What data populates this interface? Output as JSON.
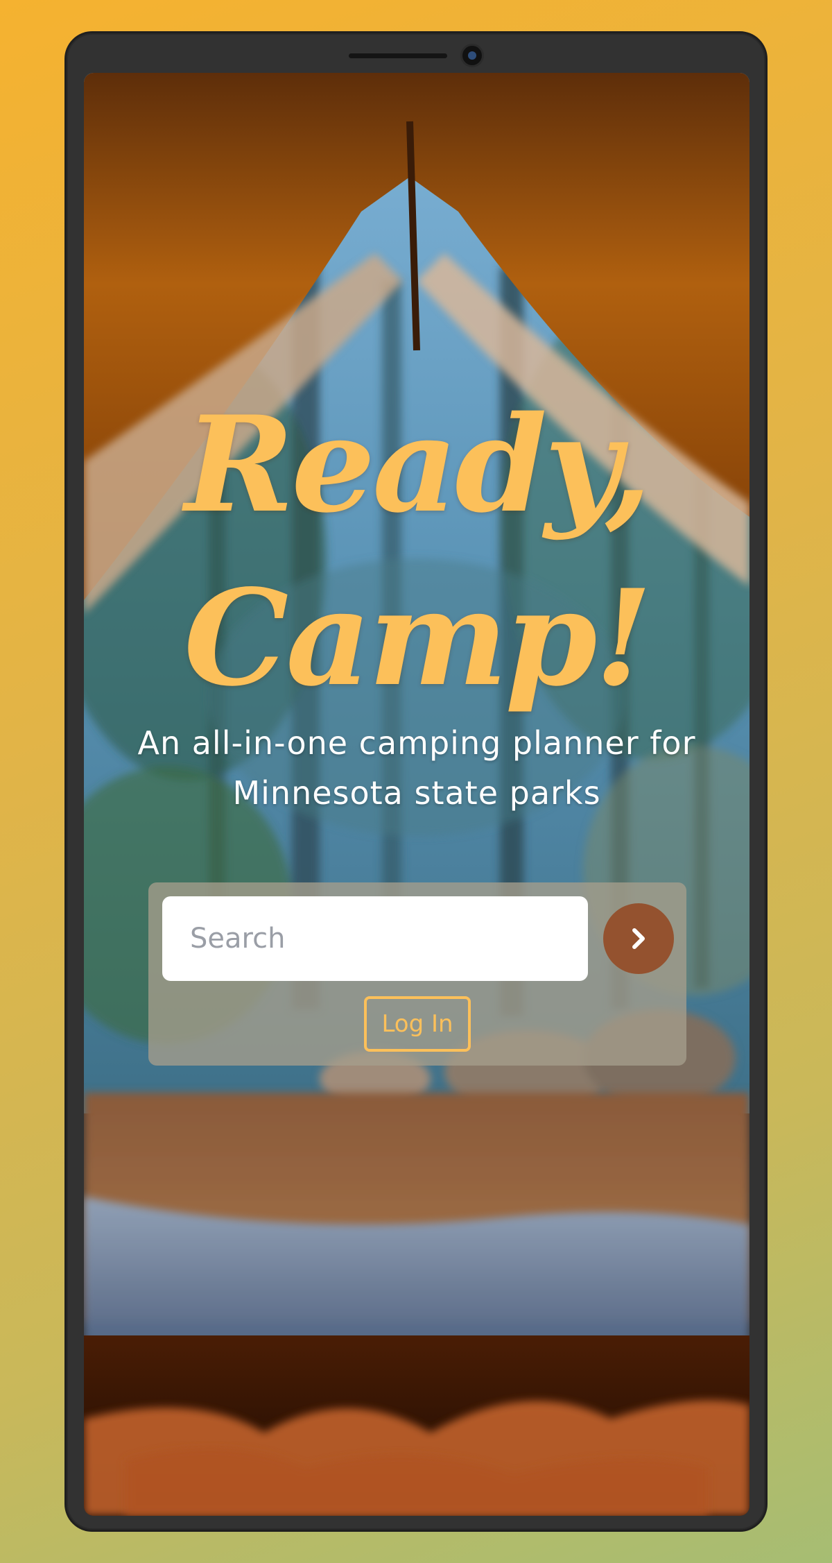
{
  "hero": {
    "title_line1": "Ready,",
    "title_line2": "Camp!",
    "subtitle_line1": "An all-in-one camping planner for",
    "subtitle_line2": "Minnesota state parks"
  },
  "search": {
    "placeholder": "Search",
    "value": "",
    "submit_icon": "chevron-right-icon"
  },
  "auth": {
    "login_label": "Log In"
  },
  "colors": {
    "accent_yellow": "#fcc05a",
    "button_brown": "#94522f",
    "page_gradient_start": "#f5b230",
    "page_gradient_end": "#a6bd73"
  }
}
